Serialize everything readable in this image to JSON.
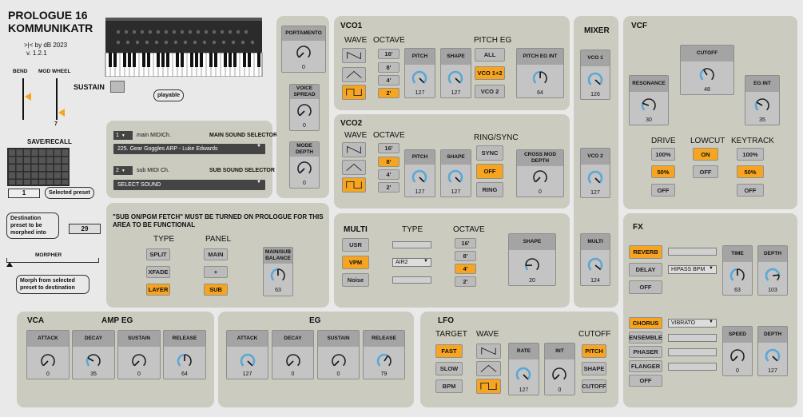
{
  "app": {
    "title_line1": "PROLOGUE 16",
    "title_line2": "KOMMUNIKATR",
    "credit": ">|< by dB 2023",
    "version": "v. 1.2.1",
    "playable": "playable"
  },
  "left": {
    "bend": "BEND",
    "mod_wheel": "MOD WHEEL",
    "mod_value": "7",
    "sustain": "SUSTAIN",
    "save_recall": "SAVE/RECALL",
    "selected_preset": "1",
    "selected_preset_label": "Selected preset",
    "destination_text": "Destination preset to be morphed into",
    "destination_value": "29",
    "morpher": "MORPHER",
    "morph_text": "Morph from selected preset to destination"
  },
  "selectors": {
    "main_ch": "1",
    "main_ch_label": "main MIDICh.",
    "main_title": "MAIN SOUND SELECTOR",
    "main_sound": "225. Gear Goggles ARP - Luke Edwards",
    "sub_ch": "2",
    "sub_ch_label": "sub MIDI Ch.",
    "sub_title": "SUB SOUND SELECTOR",
    "sub_sound": "SELECT SOUND"
  },
  "voice": {
    "portamento": "PORTAMENTO",
    "portamento_val": "0",
    "voice_spread": "VOICE SPREAD",
    "voice_spread_val": "0",
    "mode_depth": "MODE DEPTH",
    "mode_depth_val": "0"
  },
  "sub_area": {
    "warning": "\"SUB ON/PGM FETCH\" MUST BE TURNED ON PROLOGUE FOR THIS AREA TO BE FUNCTIONAL",
    "type": "TYPE",
    "panel": "PANEL",
    "split": "SPLIT",
    "xfade": "XFADE",
    "layer": "LAYER",
    "main": "MAIN",
    "plus": "+",
    "sub": "SUB",
    "balance": "MAIN/SUB BALANCE",
    "balance_val": "63"
  },
  "vco1": {
    "title": "VCO1",
    "wave": "WAVE",
    "octave": "OCTAVE",
    "oct": [
      "16'",
      "8'",
      "4'",
      "2'"
    ],
    "pitch": "PITCH",
    "pitch_val": "127",
    "shape": "SHAPE",
    "shape_val": "127",
    "pitch_eg": "PITCH EG",
    "all": "ALL",
    "vco12": "VCO 1+2",
    "vco2": "VCO 2",
    "pitch_eg_int": "PITCH EG INT",
    "pitch_eg_int_val": "64"
  },
  "vco2": {
    "title": "VCO2",
    "wave": "WAVE",
    "octave": "OCTAVE",
    "oct": [
      "16'",
      "8'",
      "4'",
      "2'"
    ],
    "pitch": "PITCH",
    "pitch_val": "127",
    "shape": "SHAPE",
    "shape_val": "127",
    "ring_sync": "RING/SYNC",
    "sync": "SYNC",
    "off": "OFF",
    "ring": "RING",
    "cross_mod": "CROSS MOD DEPTH",
    "cross_mod_val": "0"
  },
  "multi": {
    "title": "MULTI",
    "type": "TYPE",
    "octave": "OCTAVE",
    "usr": "USR",
    "vpm": "VPM",
    "noise": "Noise",
    "select": "AIR2",
    "oct": [
      "16'",
      "8'",
      "4'",
      "2'"
    ],
    "shape": "SHAPE",
    "shape_val": "20"
  },
  "mixer": {
    "title": "MIXER",
    "vco1": "VCO 1",
    "vco1_val": "126",
    "vco2": "VCO 2",
    "vco2_val": "127",
    "multi": "MULTI",
    "multi_val": "124"
  },
  "vcf": {
    "title": "VCF",
    "cutoff": "CUTOFF",
    "cutoff_val": "48",
    "resonance": "RESONANCE",
    "resonance_val": "30",
    "eg_int": "EG INT",
    "eg_int_val": "35",
    "drive": "DRIVE",
    "lowcut": "LOWCUT",
    "keytrack": "KEYTRACK",
    "d100": "100%",
    "d50": "50%",
    "doff": "OFF",
    "lon": "ON",
    "loff": "OFF",
    "k100": "100%",
    "k50": "50%",
    "koff": "OFF"
  },
  "fx": {
    "title": "FX",
    "reverb": "REVERB",
    "delay": "DELAY",
    "off": "OFF",
    "delay_sel": "HIPASS BPM",
    "time": "TIME",
    "time_val": "63",
    "depth": "DEPTH",
    "depth_val": "103",
    "chorus": "CHORUS",
    "ensemble": "ENSEMBLE",
    "phaser": "PHASER",
    "flanger": "FLANGER",
    "off2": "OFF",
    "chorus_sel": "VIBRATO",
    "speed": "SPEED",
    "speed_val": "0",
    "depth2": "DEPTH",
    "depth2_val": "127"
  },
  "vca": {
    "title": "VCA",
    "amp_eg": "AMP EG",
    "attack": "ATTACK",
    "attack_val": "0",
    "decay": "DECAY",
    "decay_val": "35",
    "sustain": "SUSTAIN",
    "sustain_val": "0",
    "release": "RELEASE",
    "release_val": "64"
  },
  "eg": {
    "title": "EG",
    "attack": "ATTACK",
    "attack_val": "127",
    "decay": "DECAY",
    "decay_val": "0",
    "sustain": "SUSTAIN",
    "sustain_val": "0",
    "release": "RELEASE",
    "release_val": "79"
  },
  "lfo": {
    "title": "LFO",
    "target": "TARGET",
    "wave": "WAVE",
    "cutoff": "CUTOFF",
    "fast": "FAST",
    "slow": "SLOW",
    "bpm": "BPM",
    "rate": "RATE",
    "rate_val": "127",
    "int": "INT",
    "int_val": "0",
    "pitch": "PITCH",
    "shape": "SHAPE",
    "cutoff_btn": "CUTOFF"
  },
  "colors": {
    "panel": "#cbcbc0",
    "accent": "#f7a521",
    "knob_arc": "#5aa8d6"
  }
}
